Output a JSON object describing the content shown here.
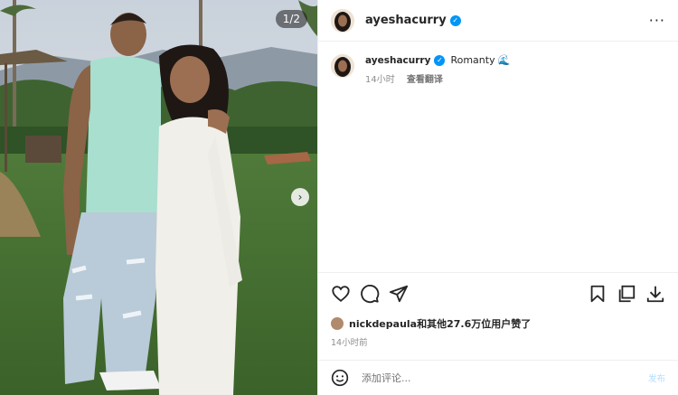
{
  "media": {
    "counter": "1/2"
  },
  "header": {
    "username": "ayeshacurry",
    "more_label": "···"
  },
  "caption": {
    "username": "ayeshacurry",
    "text": "Romanty",
    "time": "14小时",
    "translate": "查看翻译"
  },
  "likes": {
    "liker": "nickdepaula",
    "rest": "和其他27.6万位用户赞了",
    "time": "14小时前"
  },
  "comment": {
    "placeholder": "添加评论...",
    "post_label": "发布"
  },
  "colors": {
    "verified": "#0095f6",
    "post_button": "#b3dbff",
    "border": "#efefef"
  },
  "icons": [
    "heart-icon",
    "comment-icon",
    "share-icon",
    "bookmark-icon",
    "copy-icon",
    "download-icon",
    "emoji-icon",
    "wave-icon",
    "verified-icon",
    "more-icon",
    "chevron-right-icon"
  ]
}
